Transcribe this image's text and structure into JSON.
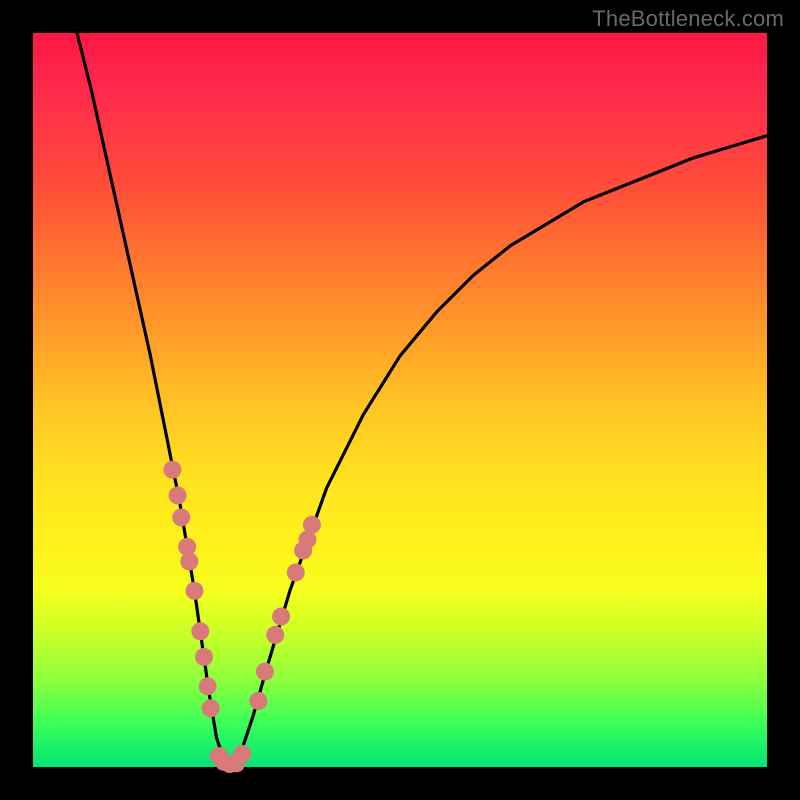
{
  "attribution": "TheBottleneck.com",
  "chart_data": {
    "type": "line",
    "title": "",
    "xlabel": "",
    "ylabel": "",
    "xlim": [
      0,
      100
    ],
    "ylim": [
      0,
      100
    ],
    "grid": false,
    "legend": false,
    "series": [
      {
        "name": "bottleneck-curve",
        "x": [
          6,
          8,
          10,
          12,
          14,
          16,
          18,
          20,
          22,
          23,
          24,
          25,
          26,
          27,
          28,
          30,
          32,
          35,
          40,
          45,
          50,
          55,
          60,
          65,
          70,
          75,
          80,
          85,
          90,
          95,
          100
        ],
        "y": [
          100,
          92,
          83,
          74,
          65,
          56,
          46,
          36,
          24,
          17,
          10,
          4,
          1,
          0,
          1,
          7,
          14,
          24,
          38,
          48,
          56,
          62,
          67,
          71,
          74,
          77,
          79,
          81,
          83,
          84.5,
          86
        ]
      }
    ],
    "markers": {
      "name": "highlight-dots",
      "color": "#d97a7a",
      "radius_px": 9,
      "points": [
        {
          "x": 19.0,
          "y": 40.5
        },
        {
          "x": 19.7,
          "y": 37.0
        },
        {
          "x": 20.2,
          "y": 34.0
        },
        {
          "x": 21.0,
          "y": 30.0
        },
        {
          "x": 21.3,
          "y": 28.0
        },
        {
          "x": 22.0,
          "y": 24.0
        },
        {
          "x": 22.8,
          "y": 18.5
        },
        {
          "x": 23.3,
          "y": 15.0
        },
        {
          "x": 23.8,
          "y": 11.0
        },
        {
          "x": 24.2,
          "y": 8.0
        },
        {
          "x": 25.3,
          "y": 1.5
        },
        {
          "x": 26.0,
          "y": 0.7
        },
        {
          "x": 26.8,
          "y": 0.4
        },
        {
          "x": 27.7,
          "y": 0.5
        },
        {
          "x": 28.5,
          "y": 1.8
        },
        {
          "x": 30.7,
          "y": 9.0
        },
        {
          "x": 31.6,
          "y": 13.0
        },
        {
          "x": 33.0,
          "y": 18.0
        },
        {
          "x": 33.8,
          "y": 20.5
        },
        {
          "x": 35.8,
          "y": 26.5
        },
        {
          "x": 36.8,
          "y": 29.5
        },
        {
          "x": 37.4,
          "y": 31.0
        },
        {
          "x": 38.0,
          "y": 33.0
        }
      ]
    }
  }
}
